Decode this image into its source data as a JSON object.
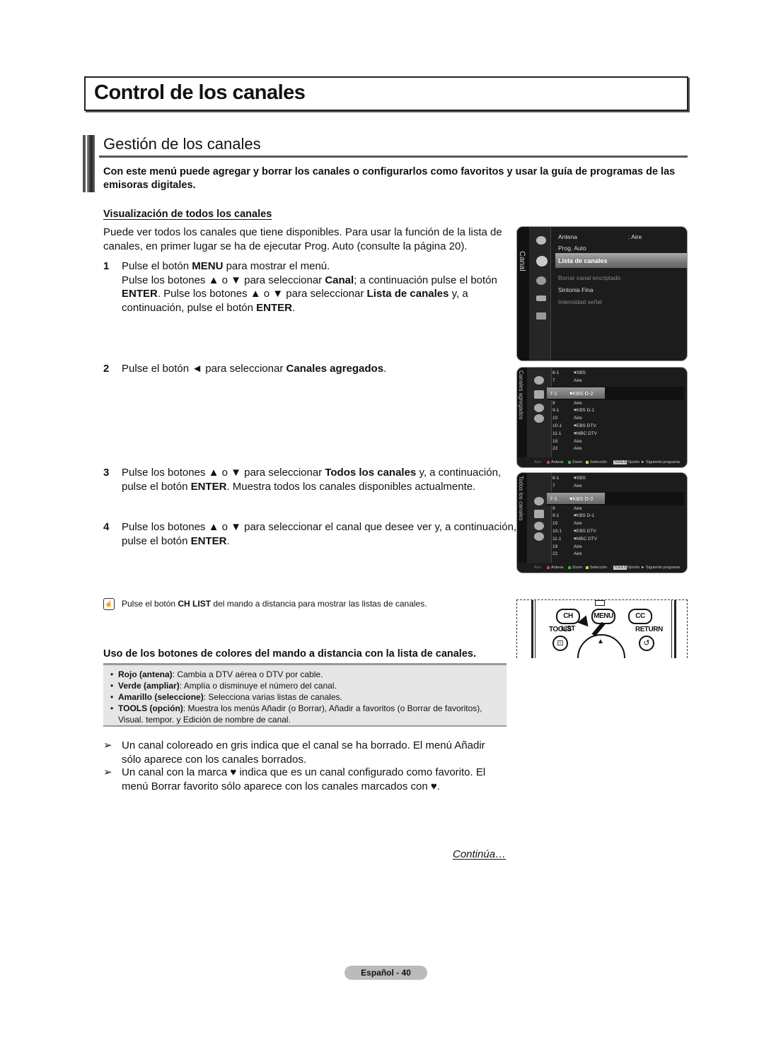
{
  "chapter_title": "Control de los canales",
  "section": {
    "title": "Gestión de los canales",
    "intro": "Con este menú puede agregar y borrar los canales o configurarlos como favoritos y usar la guía de programas de las emisoras digitales."
  },
  "subsection": {
    "title": "Visualización de todos los canales",
    "intro": "Puede ver todos los canales que tiene disponibles. Para usar la función de la lista de canales, en primer lugar se ha de ejecutar Prog. Auto (consulte la página 20)."
  },
  "steps": [
    {
      "num": "1",
      "parts": [
        {
          "t": "Pulse el botón "
        },
        {
          "b": "MENU"
        },
        {
          "t": " para mostrar el menú."
        },
        {
          "br": true
        },
        {
          "t": "Pulse los botones ▲ o ▼ para seleccionar "
        },
        {
          "b": "Canal"
        },
        {
          "t": "; a continuación pulse el botón "
        },
        {
          "b": "ENTER"
        },
        {
          "t": ". Pulse los botones ▲ o ▼ para seleccionar "
        },
        {
          "b": "Lista de canales"
        },
        {
          "t": " y, a continuación, pulse el botón "
        },
        {
          "b": "ENTER"
        },
        {
          "t": "."
        }
      ]
    },
    {
      "num": "2",
      "parts": [
        {
          "t": "Pulse el botón ◄ para seleccionar "
        },
        {
          "b": "Canales agregados"
        },
        {
          "t": "."
        }
      ]
    },
    {
      "num": "3",
      "parts": [
        {
          "t": "Pulse los botones ▲ o ▼ para seleccionar "
        },
        {
          "b": "Todos los canales"
        },
        {
          "t": " y, a continuación, pulse el botón "
        },
        {
          "b": "ENTER"
        },
        {
          "t": ". Muestra todos los canales disponibles actualmente."
        }
      ]
    },
    {
      "num": "4",
      "parts": [
        {
          "t": "Pulse los botones ▲ o ▼ para seleccionar el canal que desee ver y, a continuación, pulse el botón "
        },
        {
          "b": "ENTER"
        },
        {
          "t": "."
        }
      ]
    }
  ],
  "tv_menu": {
    "side_label": "Canal",
    "items": [
      {
        "label": "Antena",
        "value": ": Aire",
        "state": "normal"
      },
      {
        "label": "Prog. Auto",
        "state": "normal"
      },
      {
        "label": "Lista de canales",
        "state": "selected"
      },
      {
        "label": "Borrar canal encriptado",
        "state": "dim"
      },
      {
        "label": "Sintonia Fina",
        "state": "normal"
      },
      {
        "label": "Intensidad señal",
        "state": "dim"
      }
    ]
  },
  "channel_lists": [
    {
      "side_label": "Canales agregados",
      "rows": [
        {
          "num": "6-1",
          "name": "♥SBS"
        },
        {
          "num": "7",
          "name": "Aire"
        },
        {
          "num": "7-1",
          "name": "♥KBS D-2",
          "selected": true
        },
        {
          "num": "9",
          "name": "Aire"
        },
        {
          "num": "9-1",
          "name": "♥KBS D-1"
        },
        {
          "num": "10",
          "name": "Aire"
        },
        {
          "num": "10-1",
          "name": "♥EBS DTV"
        },
        {
          "num": "11-1",
          "name": "♥MBC DTV"
        },
        {
          "num": "19",
          "name": "Aire"
        },
        {
          "num": "22",
          "name": "Aire"
        }
      ]
    },
    {
      "side_label": "Todos los canales",
      "rows": [
        {
          "num": "6-1",
          "name": "♥SBS"
        },
        {
          "num": "7",
          "name": "Aire"
        },
        {
          "num": "7-1",
          "name": "♥KBS D-2",
          "selected": true
        },
        {
          "num": "9",
          "name": "Aire"
        },
        {
          "num": "9-1",
          "name": "♥KBS D-1"
        },
        {
          "num": "10",
          "name": "Aire"
        },
        {
          "num": "10-1",
          "name": "♥EBS DTV"
        },
        {
          "num": "11-1",
          "name": "♥MBC DTV"
        },
        {
          "num": "19",
          "name": "Aire"
        },
        {
          "num": "22",
          "name": "Aire"
        }
      ]
    }
  ],
  "tv_footer": {
    "source": "Aire",
    "antena": "Antena",
    "zoom": "Zoom",
    "seleccion": "Selección",
    "tools_tag": "TOOLS",
    "opcion": "Opción",
    "siguiente": "► Siguiente programa"
  },
  "remote": {
    "ch_list": "CH LIST",
    "menu": "MENU",
    "cc": "CC",
    "tools": "TOOLS",
    "return": "RETURN",
    "up_arrow": "▲"
  },
  "note": {
    "prefix": "Pulse el botón ",
    "bold": "CH LIST",
    "suffix": " del mando a distancia para mostrar las listas de canales."
  },
  "colors_section": {
    "title": "Uso de los botones de colores del mando a distancia con la lista de canales.",
    "items": [
      {
        "bold": "Rojo (antena)",
        "text": ": Cambia a DTV aérea o DTV por cable."
      },
      {
        "bold": "Verde (ampliar)",
        "text": ": Amplía o disminuye el número del canal."
      },
      {
        "bold": "Amarillo (seleccione)",
        "text": ": Selecciona varias listas de canales."
      },
      {
        "bold": "TOOLS (opción)",
        "text": ": Muestra los menús Añadir (o Borrar), Añadir a favoritos (o Borrar de favoritos), Visual. tempor. y Edición de nombre de canal."
      }
    ]
  },
  "arrow_notes": [
    "Un canal coloreado en gris indica que el canal se ha borrado. El menú Añadir sólo aparece con los canales borrados.",
    "Un canal con la marca ♥ indica que es un canal configurado como favorito. El menú Borrar favorito sólo aparece con los canales marcados con ♥."
  ],
  "continua": "Continúa…",
  "page_label": "Español - 40"
}
